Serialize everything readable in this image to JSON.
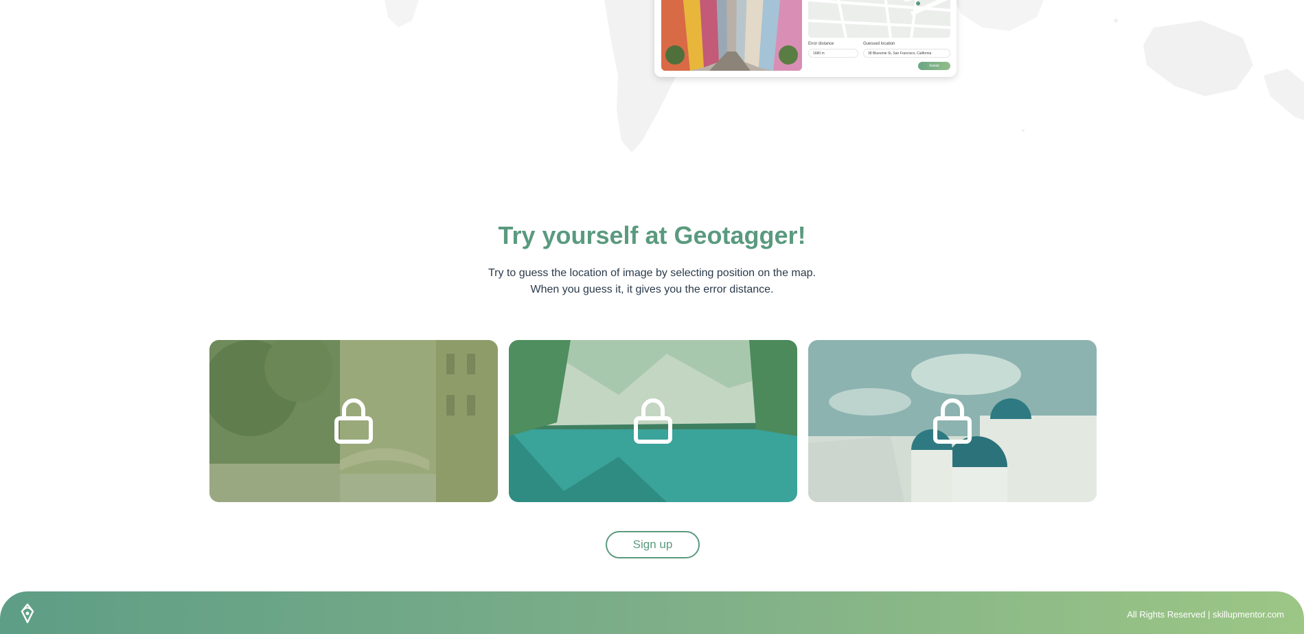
{
  "preview": {
    "error_distance_label": "Error distance",
    "error_distance_value": "1680 m",
    "guessed_location_label": "Guessed location",
    "guessed_location_value": "38 Bluesmie St, San Francisco, California",
    "button_label": "Guess"
  },
  "hero": {
    "title": "Try yourself at Geotagger!",
    "subtitle_line1": "Try to guess the location of image by selecting position on the map.",
    "subtitle_line2": "When you guess it, it gives you the error distance."
  },
  "cards": [
    {
      "name": "venice-canal",
      "icon": "lock-icon"
    },
    {
      "name": "mountain-lake",
      "icon": "lock-icon"
    },
    {
      "name": "santorini",
      "icon": "lock-icon"
    }
  ],
  "signup": {
    "label": "Sign up"
  },
  "footer": {
    "copyright": "All Rights Reserved | skillupmentor.com",
    "logo_icon": "geotagger-pin-icon"
  },
  "colors": {
    "accent": "#5a9a7e",
    "footer_gradient_start": "#5e9e86",
    "footer_gradient_end": "#9cc686",
    "text_dark": "#2a3a4a"
  }
}
